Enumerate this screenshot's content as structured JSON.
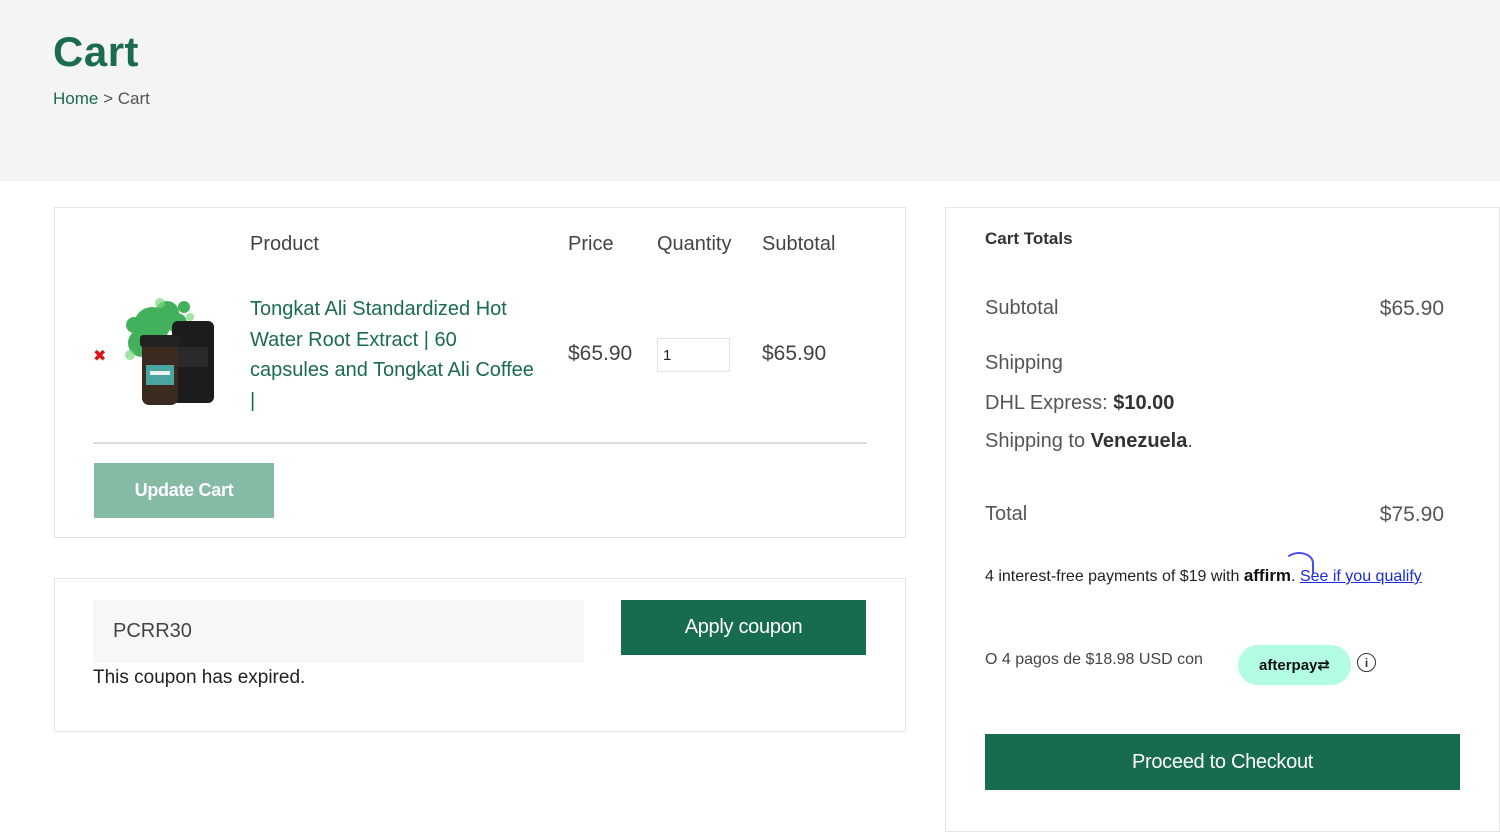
{
  "header": {
    "title": "Cart",
    "breadcrumb": {
      "home": "Home",
      "separator": " > ",
      "current": "Cart"
    }
  },
  "cart_table": {
    "columns": [
      "Product",
      "Price",
      "Quantity",
      "Subtotal"
    ],
    "items": [
      {
        "remove_icon": "✖",
        "name": "Tongkat Ali Standardized Hot Water Root Extract | 60 capsules and Tongkat Ali Coffee |",
        "price": "$65.90",
        "quantity": "1",
        "subtotal": "$65.90"
      }
    ],
    "update_label": "Update Cart"
  },
  "coupon": {
    "code": "PCRR30",
    "apply_label": "Apply coupon",
    "message": "This coupon has expired."
  },
  "totals": {
    "title": "Cart Totals",
    "subtotal_label": "Subtotal",
    "subtotal_value": "$65.90",
    "shipping_label": "Shipping",
    "shipping_method": "DHL Express:",
    "shipping_cost": "$10.00",
    "shipping_to_label": "Shipping to",
    "shipping_country": "Venezuela",
    "total_label": "Total",
    "total_value": "$75.90",
    "affirm_text": "4 interest-free payments of $19 with",
    "affirm_logo": "affirm",
    "affirm_link": "See if you qualify",
    "afterpay_text": "O 4 pagos de $18.98 USD con",
    "afterpay_logo": "afterpay⇄",
    "info_icon": "i",
    "checkout_label": "Proceed to Checkout"
  },
  "colors": {
    "brand_green": "#176b4f",
    "link_green": "#1a6b50",
    "update_button": "#85bba5",
    "afterpay_mint": "#b2fce4",
    "remove_red": "#dd1111"
  }
}
